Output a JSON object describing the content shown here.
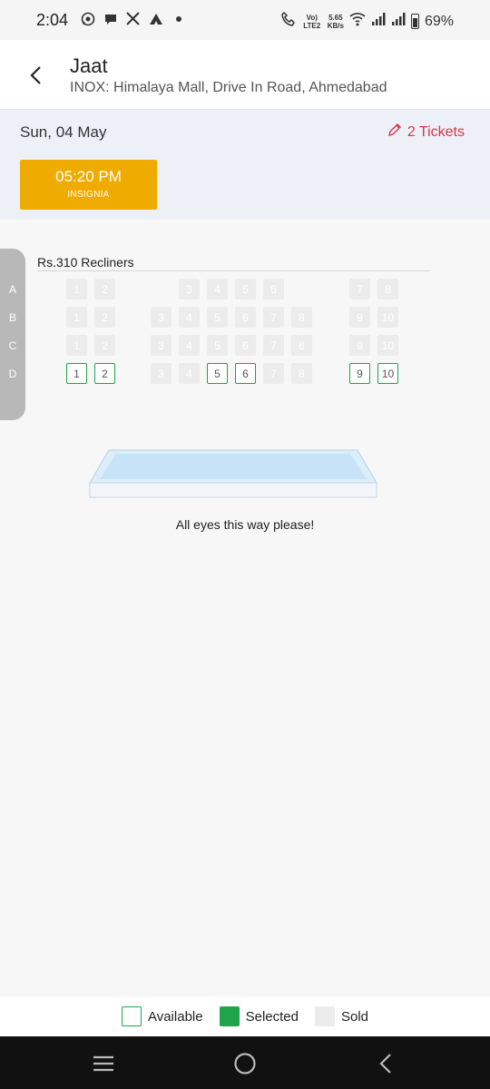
{
  "status_bar": {
    "time": "2:04",
    "lte_label": "Vo) LTE2",
    "speed_value": "5.65",
    "speed_unit": "KB/s",
    "battery": "69%",
    "icons": [
      "whatsapp-icon",
      "chat-icon",
      "x-icon",
      "app-icon",
      "dot-icon",
      "call-icon",
      "wifi-icon",
      "signal-icon",
      "signal-icon",
      "battery-icon"
    ]
  },
  "header": {
    "title": "Jaat",
    "subtitle": "INOX: Himalaya Mall, Drive In Road, Ahmedabad",
    "back_icon": "back-arrow-icon"
  },
  "show": {
    "date": "Sun, 04 May",
    "tickets_label": "2 Tickets",
    "tickets_icon": "pencil-icon",
    "time": "05:20 PM",
    "format": "INSIGNIA",
    "accent_color": "#f0ab00"
  },
  "seat_map": {
    "price_label": "Rs.310  Recliners",
    "rows": [
      {
        "letter": "A",
        "seats": [
          {
            "num": "1",
            "status": "sold"
          },
          {
            "num": "2",
            "status": "sold"
          },
          {
            "num": "3",
            "status": "sold"
          },
          {
            "num": "4",
            "status": "sold"
          },
          {
            "num": "5",
            "status": "sold"
          },
          {
            "num": "6",
            "status": "sold"
          },
          {
            "num": "7",
            "status": "sold"
          },
          {
            "num": "8",
            "status": "sold"
          }
        ]
      },
      {
        "letter": "B",
        "seats": [
          {
            "num": "1",
            "status": "sold"
          },
          {
            "num": "2",
            "status": "sold"
          },
          {
            "num": "3",
            "status": "sold"
          },
          {
            "num": "4",
            "status": "sold"
          },
          {
            "num": "5",
            "status": "sold"
          },
          {
            "num": "6",
            "status": "sold"
          },
          {
            "num": "7",
            "status": "sold"
          },
          {
            "num": "8",
            "status": "sold"
          },
          {
            "num": "9",
            "status": "sold"
          },
          {
            "num": "10",
            "status": "sold"
          }
        ]
      },
      {
        "letter": "C",
        "seats": [
          {
            "num": "1",
            "status": "sold"
          },
          {
            "num": "2",
            "status": "sold"
          },
          {
            "num": "3",
            "status": "sold"
          },
          {
            "num": "4",
            "status": "sold"
          },
          {
            "num": "5",
            "status": "sold"
          },
          {
            "num": "6",
            "status": "sold"
          },
          {
            "num": "7",
            "status": "sold"
          },
          {
            "num": "8",
            "status": "sold"
          },
          {
            "num": "9",
            "status": "sold"
          },
          {
            "num": "10",
            "status": "sold"
          }
        ]
      },
      {
        "letter": "D",
        "seats": [
          {
            "num": "1",
            "status": "available"
          },
          {
            "num": "2",
            "status": "available"
          },
          {
            "num": "3",
            "status": "sold"
          },
          {
            "num": "4",
            "status": "sold"
          },
          {
            "num": "5",
            "status": "available"
          },
          {
            "num": "6",
            "status": "available"
          },
          {
            "num": "7",
            "status": "sold"
          },
          {
            "num": "8",
            "status": "sold"
          },
          {
            "num": "9",
            "status": "available"
          },
          {
            "num": "10",
            "status": "available"
          }
        ]
      }
    ],
    "screen_text": "All eyes this way please!"
  },
  "legend": {
    "available": "Available",
    "selected": "Selected",
    "sold": "Sold",
    "available_color": "#1fa44a",
    "selected_color": "#1fa44a",
    "sold_color": "#ececec"
  },
  "nav_bar": {
    "icons": [
      "recents-icon",
      "home-icon",
      "back-icon"
    ]
  }
}
